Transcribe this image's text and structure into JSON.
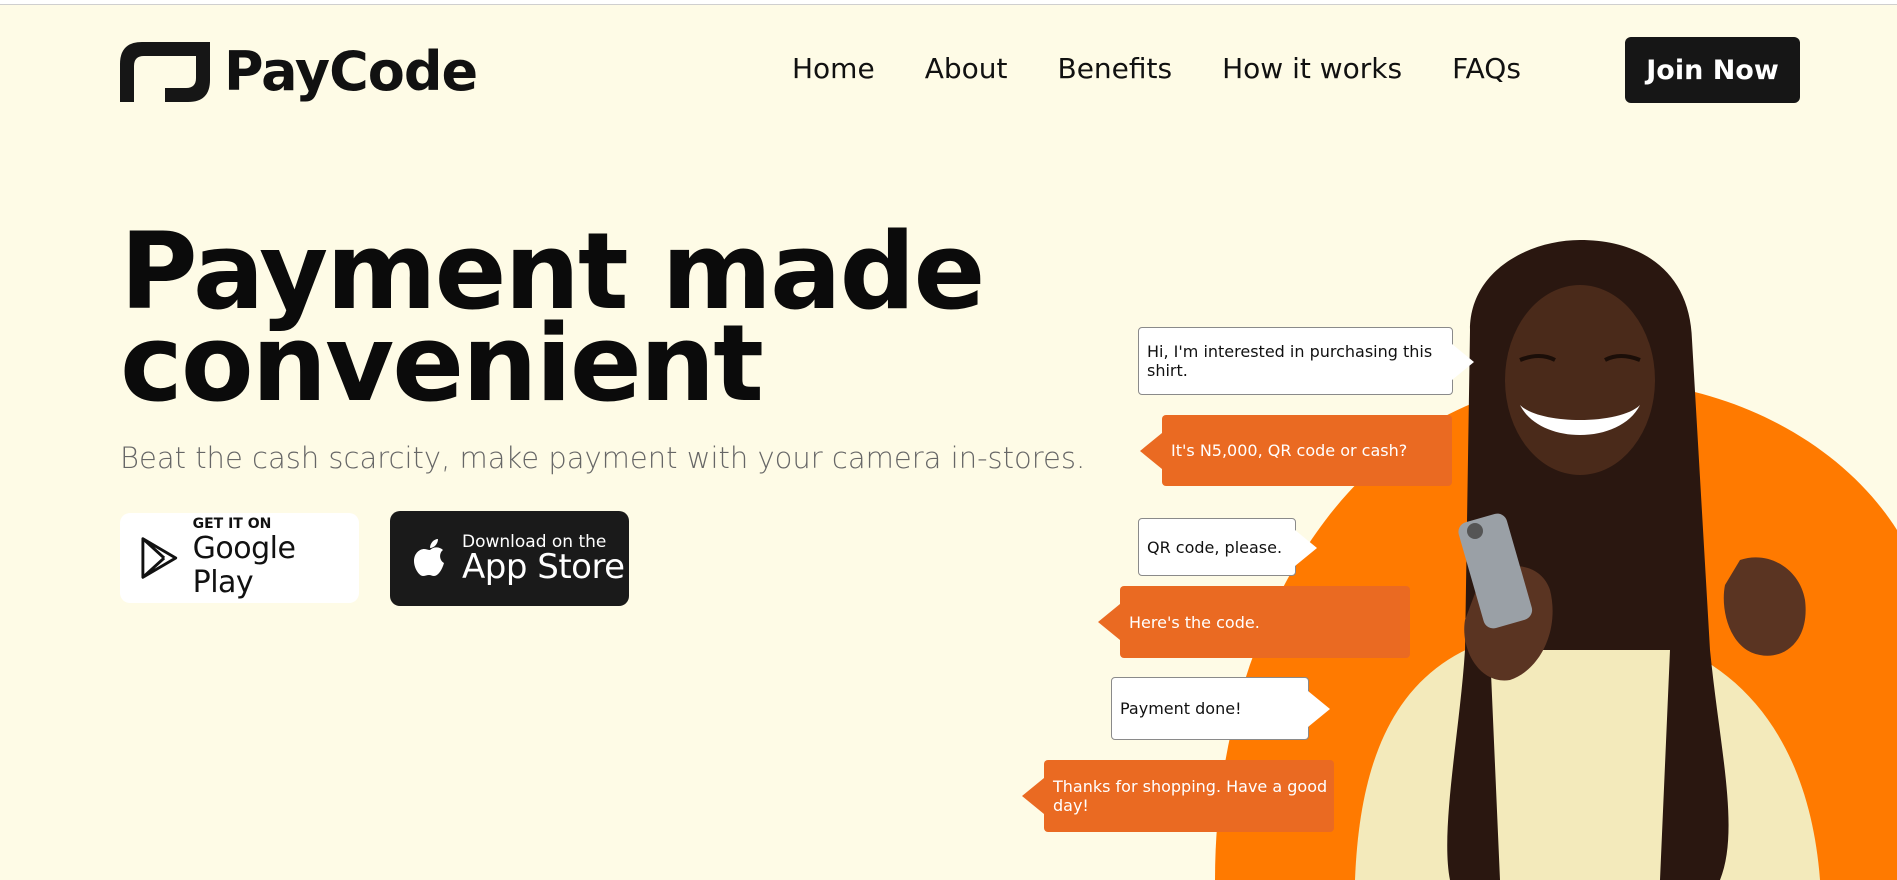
{
  "brand": {
    "name": "PayCode"
  },
  "nav": {
    "items": [
      {
        "label": "Home"
      },
      {
        "label": "About"
      },
      {
        "label": "Benefits"
      },
      {
        "label": "How it works"
      },
      {
        "label": "FAQs"
      }
    ],
    "cta_label": "Join Now"
  },
  "hero": {
    "title": "Payment made convenient",
    "subtitle": "Beat the cash scarcity, make payment with your camera in-stores.",
    "google_play": {
      "small": "GET IT ON",
      "big": "Google Play",
      "icon": "google-play-icon"
    },
    "app_store": {
      "small": "Download on the",
      "big": "App Store",
      "icon": "apple-icon"
    }
  },
  "chat": [
    {
      "text": "Hi, I'm interested in purchasing this shirt.",
      "style": "white"
    },
    {
      "text": "It's N5,000, QR code or cash?",
      "style": "orange"
    },
    {
      "text": "QR code, please.",
      "style": "white"
    },
    {
      "text": "Here's the code.",
      "style": "orange"
    },
    {
      "text": "Payment done!",
      "style": "white"
    },
    {
      "text": "Thanks for shopping. Have a good day!",
      "style": "orange"
    }
  ],
  "colors": {
    "background": "#fefbe6",
    "accent": "#ea6a22",
    "dark": "#161616"
  }
}
